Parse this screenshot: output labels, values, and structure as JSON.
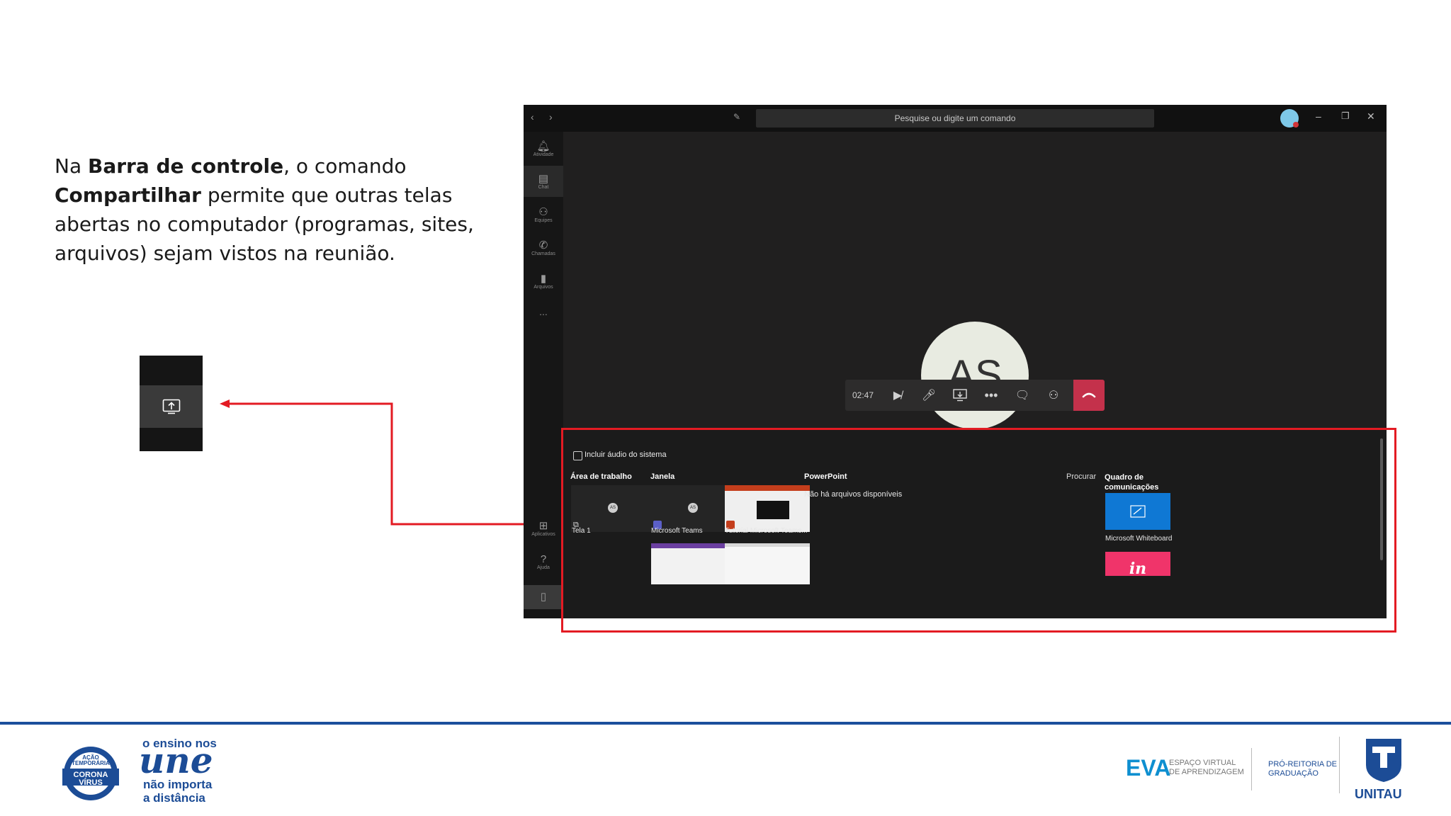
{
  "instruction": {
    "part1": "Na ",
    "bold1": "Barra de controle",
    "part2": ", o comando ",
    "bold2": "Compartilhar",
    "part3": " permite que outras telas abertas no computador (programas, sites, arquivos) sejam vistos na reunião."
  },
  "teams": {
    "search_placeholder": "Pesquise ou digite um comando",
    "rail": [
      {
        "label": "Atividade",
        "icon": "bell-icon"
      },
      {
        "label": "Chat",
        "icon": "chat-icon"
      },
      {
        "label": "Equipes",
        "icon": "teams-icon"
      },
      {
        "label": "Chamadas",
        "icon": "phone-icon"
      },
      {
        "label": "Arquivos",
        "icon": "file-icon"
      },
      {
        "label": "...",
        "icon": "more-icon"
      },
      {
        "label": "Aplicativos",
        "icon": "apps-icon"
      },
      {
        "label": "Ajuda",
        "icon": "help-icon"
      }
    ],
    "participant_initials": "AS",
    "call_timer": "02:47",
    "share_tray": {
      "include_audio_label": "Incluir áudio do sistema",
      "desktop_title": "Área de trabalho",
      "window_title": "Janela",
      "powerpoint_title": "PowerPoint",
      "browse_label": "Procurar",
      "whiteboard_title": "Quadro de comunicações",
      "no_files": "Não há arquivos disponíveis",
      "screen_label": "Tela 1",
      "windows": [
        "Microsoft Teams",
        "Tutorial Microsoft Teams..."
      ],
      "whiteboard_app": "Microsoft Whiteboard",
      "thumb_initials": "AS",
      "invision_glyph": "in"
    },
    "colors": {
      "hangup": "#c4314b",
      "whiteboard": "#0f78d4",
      "invision": "#f0346a",
      "highlight": "#e31b23"
    }
  },
  "footer": {
    "campaign_badge": [
      "AÇÃO",
      "TEMPORÁRIA",
      "CORONA",
      "VÍRUS"
    ],
    "slogan_top": "o ensino nos",
    "slogan_script": "une",
    "slogan_bottom1": "não importa",
    "slogan_bottom2": "a distância",
    "eva": "EVA",
    "eva_sub1": "ESPAÇO VIRTUAL",
    "eva_sub2": "DE APRENDIZAGEM",
    "prg1": "PRÓ-REITORIA DE",
    "prg2": "GRADUAÇÃO",
    "unitau": "UNITAU"
  }
}
